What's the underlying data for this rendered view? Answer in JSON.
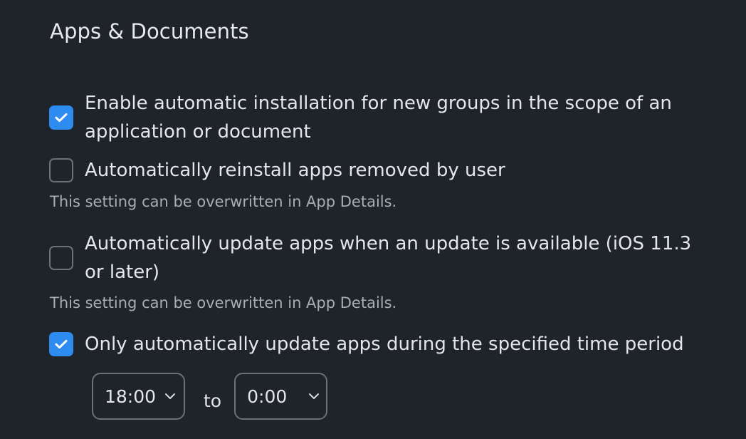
{
  "section": {
    "title": "Apps & Documents"
  },
  "options": [
    {
      "label": "Enable automatic installation for new groups in the scope of an application or document",
      "checked": true
    },
    {
      "label": "Automatically reinstall apps removed by user",
      "checked": false,
      "hint": "This setting can be overwritten in App Details."
    },
    {
      "label": "Automatically update apps when an update is available (iOS 11.3 or later)",
      "checked": false,
      "hint": "This setting can be overwritten in App Details."
    },
    {
      "label": "Only automatically update apps during the specified time period",
      "checked": true
    }
  ],
  "time_period": {
    "start": "18:00",
    "separator": "to",
    "end": "0:00"
  },
  "icons": {
    "check": "checkmark-icon",
    "dropdown": "chevron-down-icon"
  },
  "colors": {
    "background": "#1f232a",
    "accent": "#2e8cf0",
    "text": "#e4e6ea",
    "hint": "#a9adb4",
    "border": "#6b7079"
  }
}
